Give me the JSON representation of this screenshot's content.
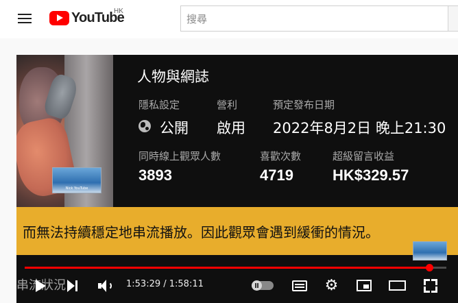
{
  "header": {
    "logo_text": "YouTube",
    "region": "HK",
    "search_placeholder": "搜尋"
  },
  "stream_overlay": {
    "category": "人物與網誌",
    "privacy_label": "隱私設定",
    "privacy_value": "公開",
    "monetization_label": "營利",
    "monetization_value": "啟用",
    "schedule_label": "預定發布日期",
    "schedule_value": "2022年8月2日 晚上21:30",
    "concurrent_label": "同時線上觀眾人數",
    "concurrent_value": "3893",
    "likes_label": "喜歡次數",
    "likes_value": "4719",
    "superchat_label": "超級留言收益",
    "superchat_value": "HK$329.57",
    "watermark_text": "Nick YouTube"
  },
  "banner": {
    "text": "而無法持續穩定地串流播放。因此觀眾會遇到緩衝的情況。"
  },
  "player": {
    "subtitle_fragment": "串流狀況",
    "time_display": "1:53:29 / 1:58:11",
    "progress_fraction": 0.96,
    "icons": [
      "play-icon",
      "next-icon",
      "volume-icon",
      "autoplay-toggle",
      "subtitles-icon",
      "settings-icon",
      "miniplayer-icon",
      "theater-icon",
      "fullscreen-icon"
    ]
  },
  "colors": {
    "brand_red": "#ff0000",
    "banner_yellow": "#e8ad2c",
    "player_bg": "#0f0f0f"
  }
}
